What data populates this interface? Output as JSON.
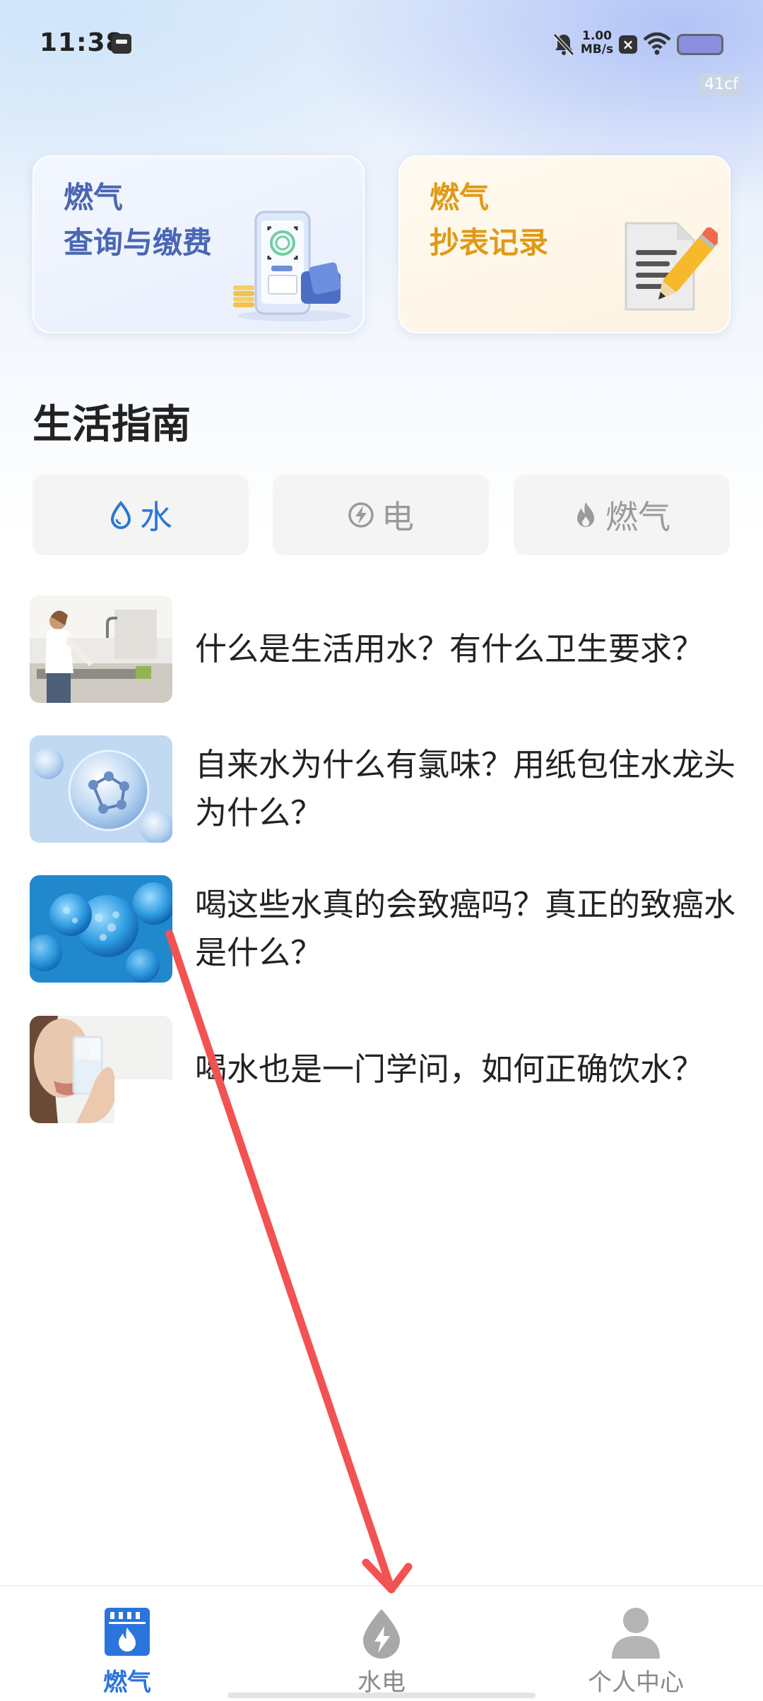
{
  "status_bar": {
    "time": "11:38",
    "speed_value": "1.00",
    "speed_unit": "MB/s",
    "icons": [
      "sim-card-icon",
      "bell-muted-icon",
      "close-badge-icon",
      "wifi-icon",
      "battery-icon"
    ],
    "debug_tag": "41cf"
  },
  "cards": {
    "left": {
      "line1": "燃气",
      "line2": "查询与缴费",
      "art_icon": "phone-fingerprint-payment-icon",
      "color": "#4a66b4"
    },
    "right": {
      "line1": "燃气",
      "line2": "抄表记录",
      "art_icon": "document-pencil-icon",
      "color": "#df9a16"
    }
  },
  "guide": {
    "title": "生活指南",
    "tabs": [
      {
        "label": "水",
        "icon": "water-drop-icon",
        "active": true,
        "color": "#2a78d4"
      },
      {
        "label": "电",
        "icon": "lightning-icon",
        "active": false,
        "color": "#9a9a9a"
      },
      {
        "label": "燃气",
        "icon": "flame-icon",
        "active": false,
        "color": "#9a9a9a"
      }
    ],
    "articles": [
      {
        "title": "什么是生活用水？有什么卫生要求？",
        "thumb": "woman-at-kitchen-sink-image"
      },
      {
        "title": "自来水为什么有氯味？用纸包住水龙头为什么？",
        "thumb": "water-molecules-image"
      },
      {
        "title": "喝这些水真的会致癌吗？真正的致癌水是什么？",
        "thumb": "blue-cells-image"
      },
      {
        "title": "喝水也是一门学问，如何正确饮水？",
        "thumb": "woman-drinking-water-image"
      }
    ]
  },
  "bottom_nav": {
    "items": [
      {
        "label": "燃气",
        "icon": "gas-meter-icon",
        "active": true
      },
      {
        "label": "水电",
        "icon": "water-electric-drop-icon",
        "active": false
      },
      {
        "label": "个人中心",
        "icon": "user-profile-icon",
        "active": false
      }
    ]
  },
  "overlay": {
    "arrow_color": "#f25252",
    "arrow_icon": "annotation-arrow"
  }
}
